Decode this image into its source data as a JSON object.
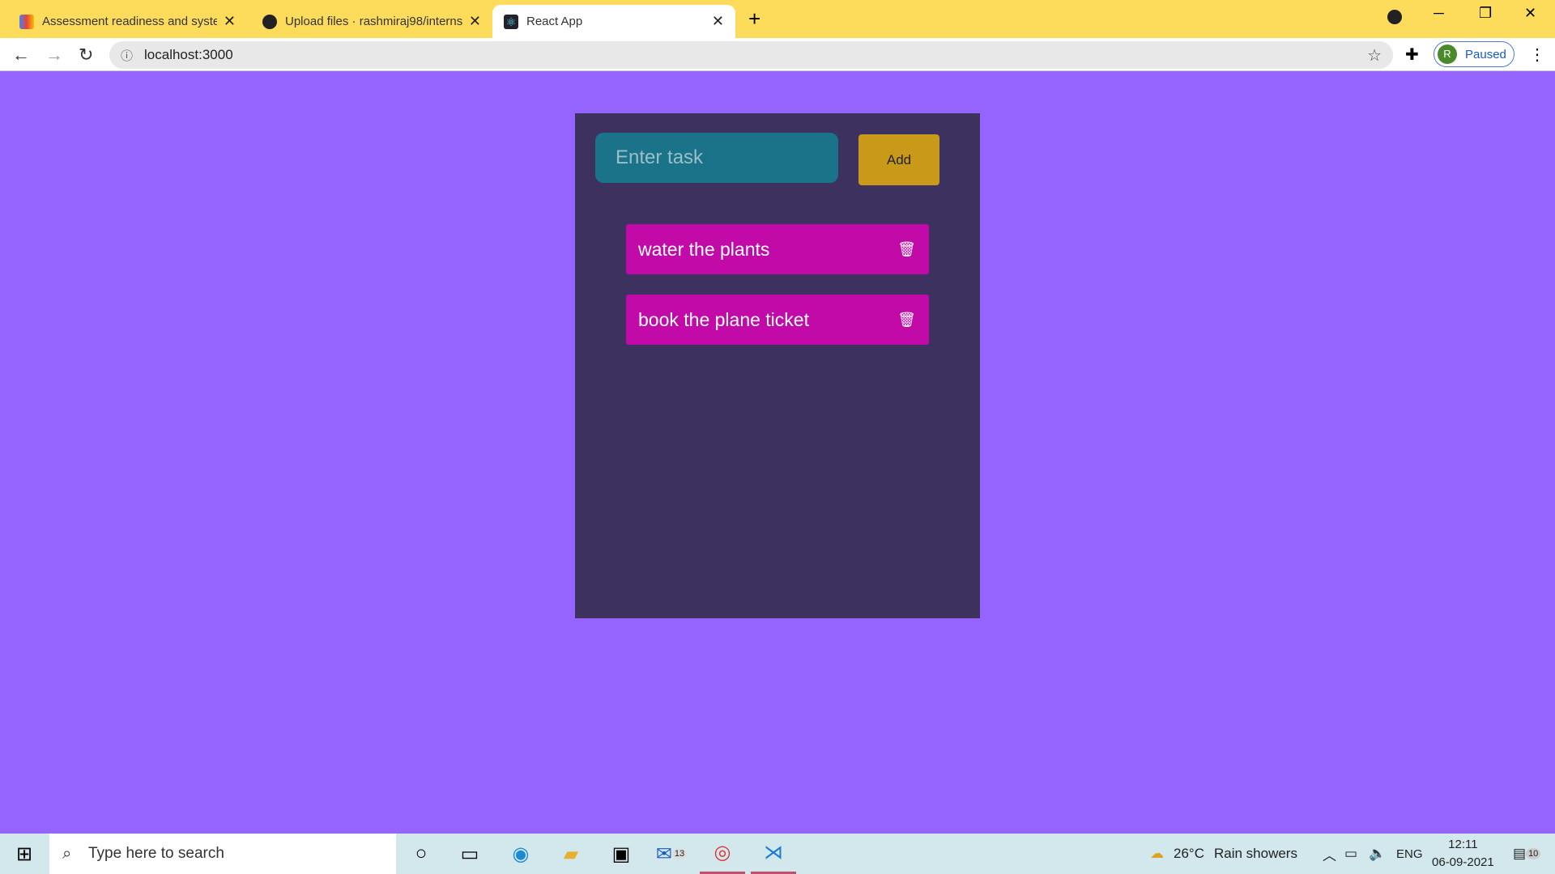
{
  "browser": {
    "tabs": [
      {
        "title": "Assessment readiness and system",
        "icon": "gmail-icon",
        "active": false
      },
      {
        "title": "Upload files · rashmiraj98/interns",
        "icon": "github-icon",
        "active": false
      },
      {
        "title": "React App",
        "icon": "react-icon",
        "active": true
      }
    ],
    "url": "localhost:3000",
    "profile_initial": "R",
    "profile_status": "Paused"
  },
  "app": {
    "input_placeholder": "Enter task",
    "input_value": "",
    "add_label": "Add",
    "tasks": [
      {
        "text": "water the plants"
      },
      {
        "text": "book the plane ticket"
      }
    ],
    "colors": {
      "background": "#9563fe",
      "panel": "#3d3160",
      "input": "#1b7389",
      "add_button": "#c99a1a",
      "task": "#c10aa8"
    }
  },
  "taskbar": {
    "search_placeholder": "Type here to search",
    "mail_badge": "13",
    "weather": "26°C",
    "weather_desc": "Rain showers",
    "language": "ENG",
    "time": "12:11",
    "date": "06-09-2021",
    "notifications": "10"
  }
}
